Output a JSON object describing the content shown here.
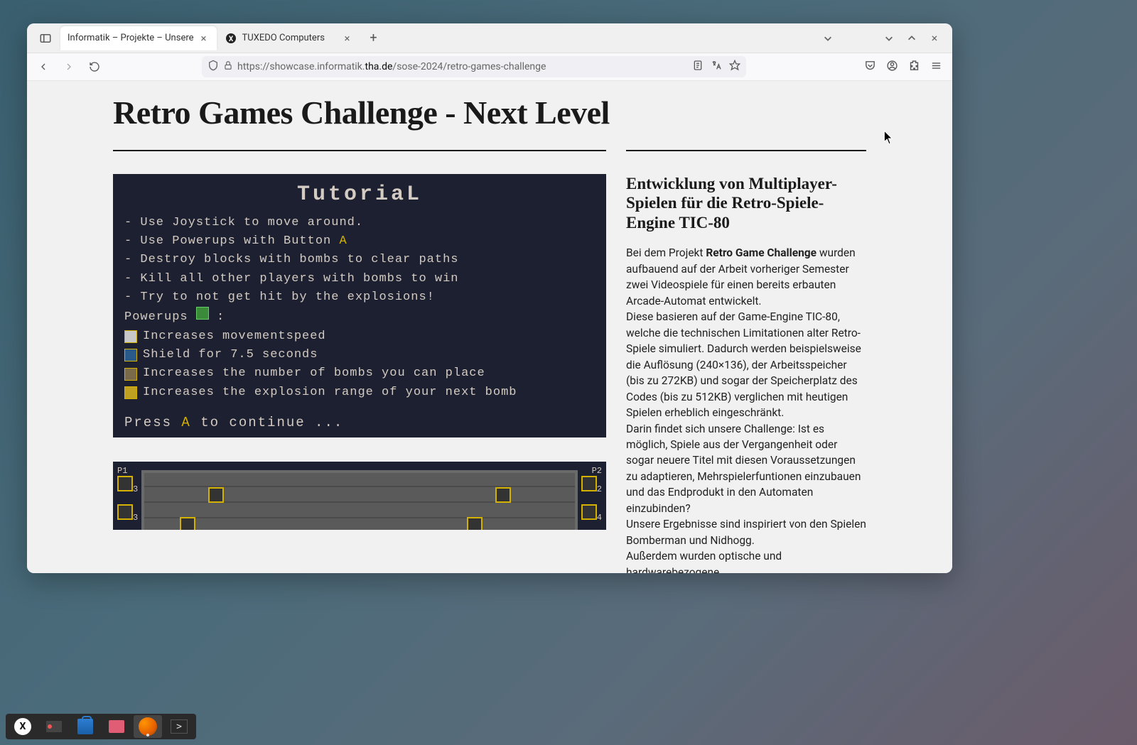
{
  "browser": {
    "tabs": [
      {
        "label": "Informatik – Projekte – Unsere",
        "active": true
      },
      {
        "label": "TUXEDO Computers",
        "active": false
      }
    ],
    "url_prefix": "https://showcase.informatik.",
    "url_domain": "tha.de",
    "url_suffix": "/sose-2024/retro-games-challenge"
  },
  "page": {
    "title": "Retro Games Challenge - Next Level",
    "tutorial": {
      "heading": "TutoriaL",
      "lines": [
        "- Use Joystick to move around.",
        "- Use Powerups with Button",
        "- Destroy blocks with bombs to clear paths",
        "- Kill all other players with bombs to win",
        "- Try to not get hit by the explosions!"
      ],
      "button_a": "A",
      "powerups_label": "Powerups",
      "powerups": [
        "Increases movementspeed",
        "Shield for 7.5 seconds",
        "Increases the number of bombs you can place",
        "Increases the explosion range of your next bomb"
      ],
      "press_prefix": "Press ",
      "press_a": "A",
      "press_suffix": " to continue ..."
    },
    "hud": {
      "p1": "P1",
      "p2": "P2",
      "n3a": "3",
      "n3b": "3",
      "n2": "2",
      "n4": "4"
    },
    "sidebar": {
      "heading": "Entwicklung von Multiplayer-Spielen für die Retro-Spiele-Engine TIC-80",
      "p1_pre": "Bei dem Projekt ",
      "p1_bold": "Retro Game Challenge",
      "p1_post": " wurden aufbauend auf der Arbeit vorheriger Semester zwei Videospiele für einen bereits erbauten Arcade-Automat entwickelt.",
      "p2": "Diese basieren auf der Game-Engine TIC-80, welche die technischen Limitationen alter Retro-Spiele simuliert. Dadurch werden beispielsweise die Auflösung (240×136), der Arbeitsspeicher (bis zu 272KB) und sogar der Speicherplatz des Codes (bis zu 512KB) verglichen mit heutigen Spielen erheblich eingeschränkt.",
      "p3": "Darin findet sich unsere Challenge: Ist es möglich, Spiele aus der Vergangenheit oder sogar neuere Titel mit diesen Voraussetzungen zu adaptieren, Mehrspielerfuntionen einzubauen und das Endprodukt in den Automaten einzubinden?",
      "p4": "Unsere Ergebnisse sind inspiriert von den Spielen Bomberman und Nidhogg.",
      "p5": "Außerdem wurden optische und hardwarebezogene"
    }
  }
}
